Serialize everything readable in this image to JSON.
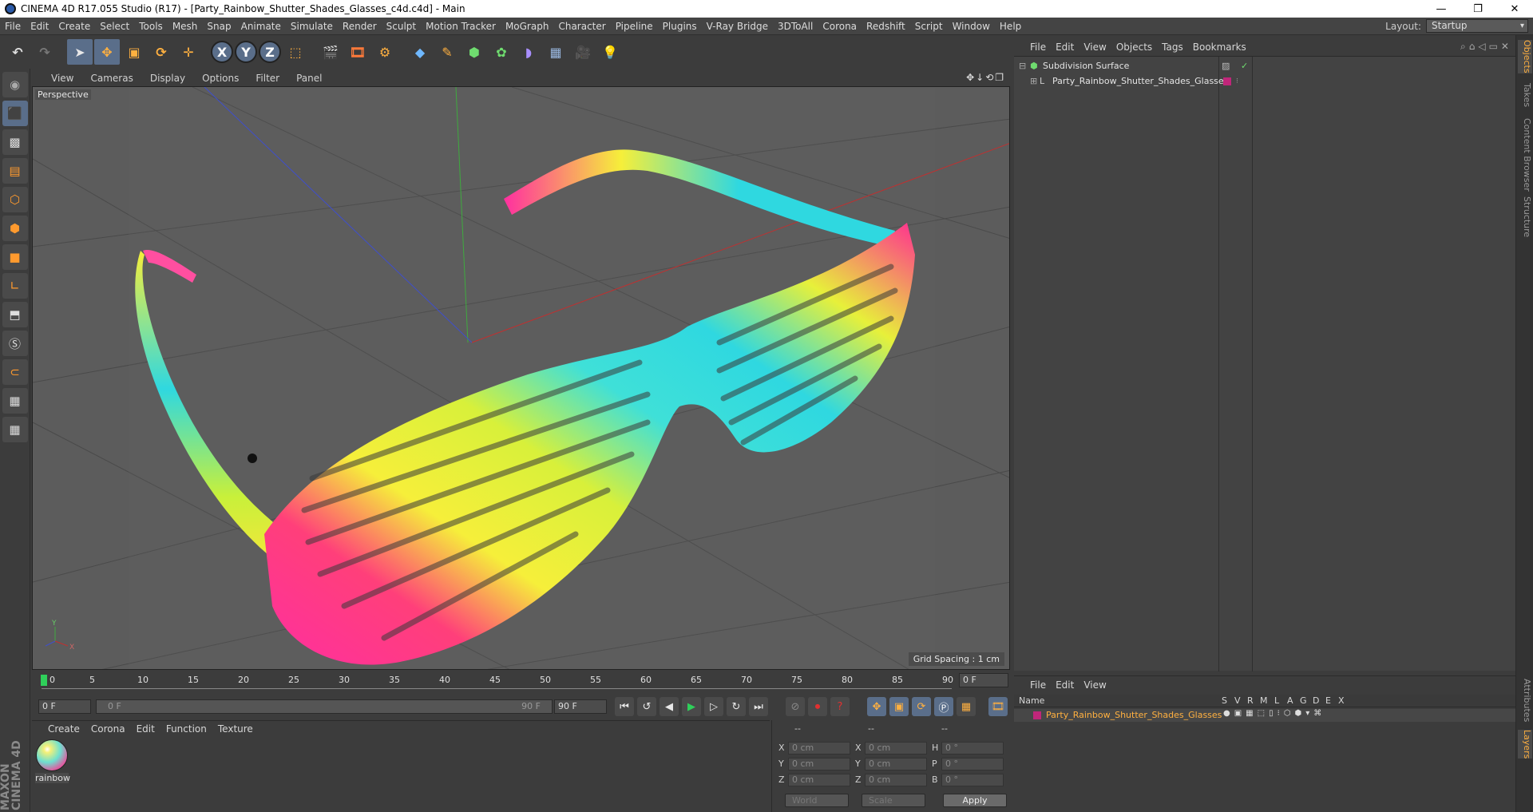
{
  "window": {
    "title": "CINEMA 4D R17.055 Studio (R17) - [Party_Rainbow_Shutter_Shades_Glasses_c4d.c4d] - Main",
    "controls": [
      "—",
      "❐",
      "✕"
    ]
  },
  "menubar": {
    "items": [
      "File",
      "Edit",
      "Create",
      "Select",
      "Tools",
      "Mesh",
      "Snap",
      "Animate",
      "Simulate",
      "Render",
      "Sculpt",
      "Motion Tracker",
      "MoGraph",
      "Character",
      "Pipeline",
      "Plugins",
      "V-Ray Bridge",
      "3DToAll",
      "Corona",
      "Redshift",
      "Script",
      "Window",
      "Help"
    ],
    "layout_label": "Layout:",
    "layout_value": "Startup"
  },
  "toolbar": {
    "axis_x": "X",
    "axis_y": "Y",
    "axis_z": "Z"
  },
  "viewport": {
    "menu": [
      "View",
      "Cameras",
      "Display",
      "Options",
      "Filter",
      "Panel"
    ],
    "camera_label": "Perspective",
    "grid_spacing": "Grid Spacing : 1 cm",
    "nav_icons": "✥↓⟲❐"
  },
  "timeline": {
    "ticks": [
      "0",
      "5",
      "10",
      "15",
      "20",
      "25",
      "30",
      "35",
      "40",
      "45",
      "50",
      "55",
      "60",
      "65",
      "70",
      "75",
      "80",
      "85",
      "90"
    ],
    "end_frame_field": "0 F"
  },
  "transport": {
    "current_frame": "0 F",
    "range_start": "0 F",
    "range_end": "90 F",
    "max_frame": "90 F"
  },
  "material_manager": {
    "menu": [
      "Create",
      "Corona",
      "Edit",
      "Function",
      "Texture"
    ],
    "materials": [
      {
        "name": "rainbow"
      }
    ]
  },
  "coordinates": {
    "header": [
      "--",
      "--",
      "--"
    ],
    "rows": [
      {
        "label1": "X",
        "val1": "0 cm",
        "label2": "X",
        "val2": "0 cm",
        "label3": "H",
        "val3": "0 °"
      },
      {
        "label1": "Y",
        "val1": "0 cm",
        "label2": "Y",
        "val2": "0 cm",
        "label3": "P",
        "val3": "0 °"
      },
      {
        "label1": "Z",
        "val1": "0 cm",
        "label2": "Z",
        "val2": "0 cm",
        "label3": "B",
        "val3": "0 °"
      }
    ],
    "mode1": "World",
    "mode2": "Scale",
    "apply": "Apply"
  },
  "object_manager": {
    "menu": [
      "File",
      "Edit",
      "View",
      "Objects",
      "Tags",
      "Bookmarks"
    ],
    "objects": [
      {
        "name": "Subdivision Surface",
        "indent": 0
      },
      {
        "name": "Party_Rainbow_Shutter_Shades_Glasses",
        "indent": 1
      }
    ]
  },
  "layer_manager": {
    "menu": [
      "File",
      "Edit",
      "View"
    ],
    "columns": [
      "Name",
      "S",
      "V",
      "R",
      "M",
      "L",
      "A",
      "G",
      "D",
      "E",
      "X"
    ],
    "layers": [
      {
        "name": "Party_Rainbow_Shutter_Shades_Glasses",
        "color": "#c0267a"
      }
    ]
  },
  "right_tabs": {
    "top": [
      "Objects",
      "Takes",
      "Content Browser",
      "Structure"
    ],
    "bottom": [
      "Attributes",
      "Layers"
    ]
  },
  "branding": {
    "text": "MAXON CINEMA 4D"
  },
  "colors": {
    "accent": "#ffb040",
    "selection_blue": "#5a6e8a",
    "layer_color": "#c0267a",
    "playhead": "#2fd05a"
  }
}
